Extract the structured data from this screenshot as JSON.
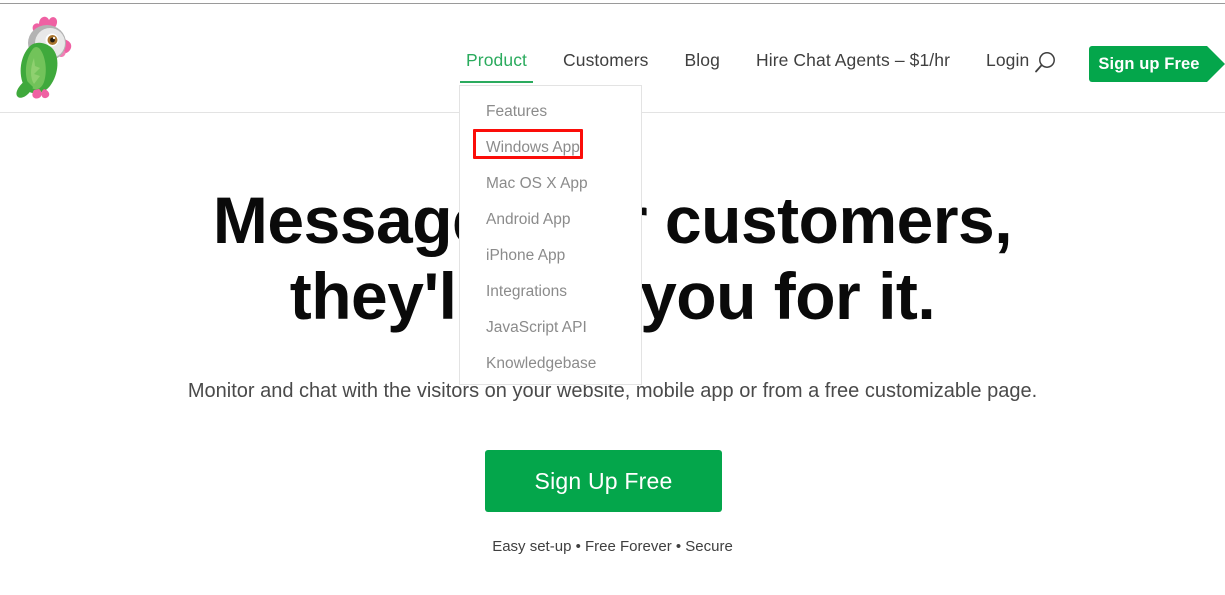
{
  "brand": {
    "logo_name": "parrot-logo",
    "accent_green": "#04a64b",
    "nav_active_green": "#2bab5e",
    "highlight_red": "#fb0d09"
  },
  "header": {
    "nav": [
      {
        "label": "Product",
        "active": true,
        "has_dropdown": true
      },
      {
        "label": "Customers",
        "active": false,
        "has_dropdown": false
      },
      {
        "label": "Blog",
        "active": false,
        "has_dropdown": false
      },
      {
        "label": "Hire Chat Agents – $1/hr",
        "active": false,
        "has_dropdown": false
      },
      {
        "label": "Login",
        "active": false,
        "has_dropdown": false
      }
    ],
    "search_icon": "search-icon",
    "signup_label": "Sign up Free"
  },
  "dropdown": {
    "owner": "Product",
    "items": [
      {
        "label": "Features",
        "highlighted": false
      },
      {
        "label": "Windows App",
        "highlighted": true
      },
      {
        "label": "Mac OS X App",
        "highlighted": false
      },
      {
        "label": "Android App",
        "highlighted": false
      },
      {
        "label": "iPhone App",
        "highlighted": false
      },
      {
        "label": "Integrations",
        "highlighted": false
      },
      {
        "label": "JavaScript API",
        "highlighted": false
      },
      {
        "label": "Knowledgebase",
        "highlighted": false
      }
    ]
  },
  "hero": {
    "headline_line1": "Message your customers,",
    "headline_line2": "they'll love you for it.",
    "subhead": "Monitor and chat with the visitors on your website, mobile app or from a free customizable page.",
    "cta_label": "Sign Up Free",
    "cta_note": "Easy set-up • Free Forever • Secure"
  }
}
